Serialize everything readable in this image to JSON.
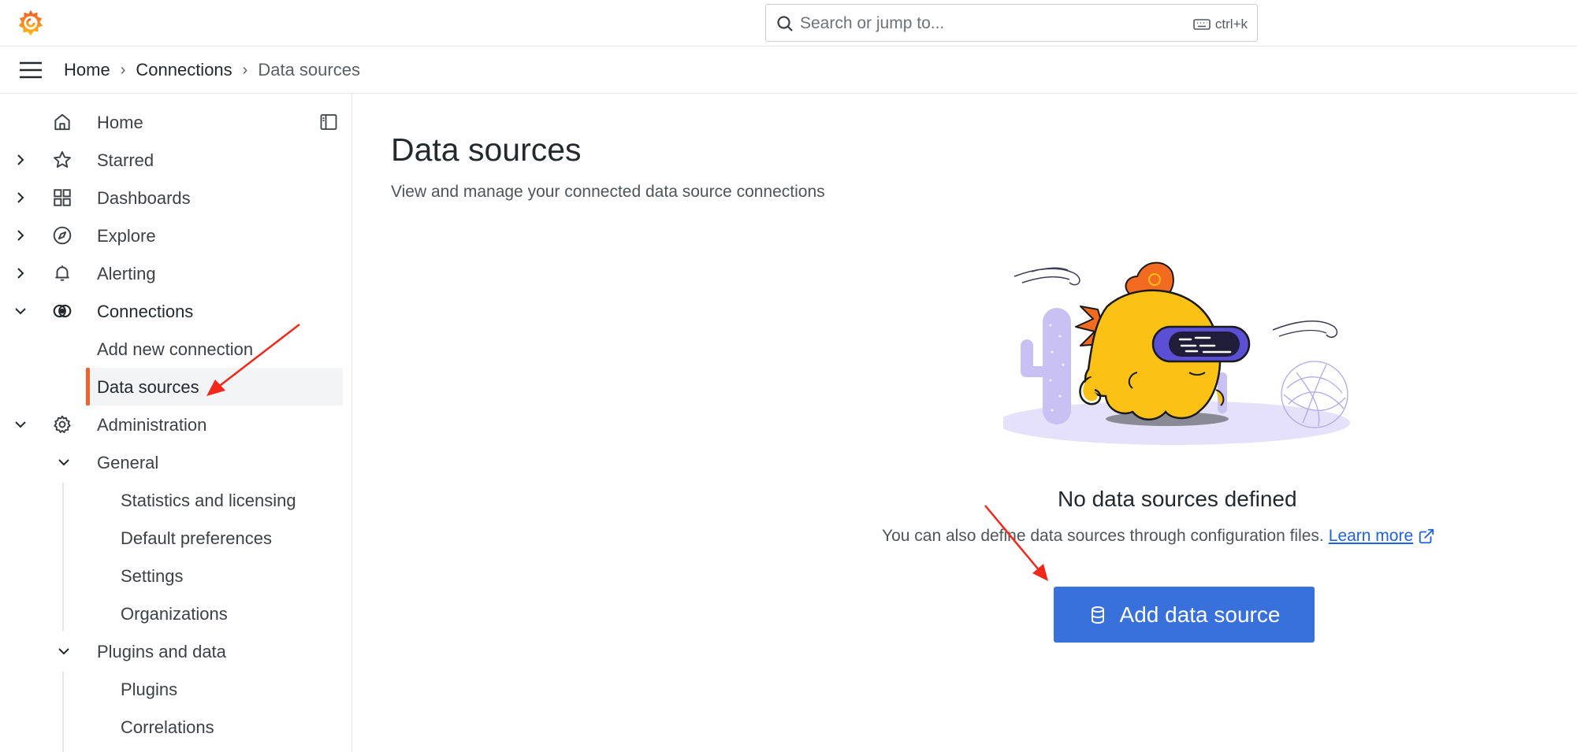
{
  "search": {
    "placeholder": "Search or jump to...",
    "shortcut": "ctrl+k"
  },
  "breadcrumb": {
    "items": [
      "Home",
      "Connections",
      "Data sources"
    ]
  },
  "sidebar": {
    "items": [
      {
        "label": "Home",
        "icon": "home-icon"
      },
      {
        "label": "Starred",
        "icon": "star-icon"
      },
      {
        "label": "Dashboards",
        "icon": "grid-icon"
      },
      {
        "label": "Explore",
        "icon": "compass-icon"
      },
      {
        "label": "Alerting",
        "icon": "bell-icon"
      },
      {
        "label": "Connections",
        "icon": "connections-icon"
      },
      {
        "label": "Add new connection"
      },
      {
        "label": "Data sources"
      },
      {
        "label": "Administration",
        "icon": "gear-icon"
      },
      {
        "label": "General"
      },
      {
        "label": "Statistics and licensing"
      },
      {
        "label": "Default preferences"
      },
      {
        "label": "Settings"
      },
      {
        "label": "Organizations"
      },
      {
        "label": "Plugins and data"
      },
      {
        "label": "Plugins"
      },
      {
        "label": "Correlations"
      }
    ]
  },
  "main": {
    "title": "Data sources",
    "subtitle": "View and manage your connected data source connections",
    "empty": {
      "title": "No data sources defined",
      "text": "You can also define data sources through configuration files.",
      "link": "Learn more"
    },
    "add_button": "Add data source"
  },
  "colors": {
    "accent": "#3871dc",
    "active_indicator": "#f0612e",
    "link": "#1f62e0"
  }
}
